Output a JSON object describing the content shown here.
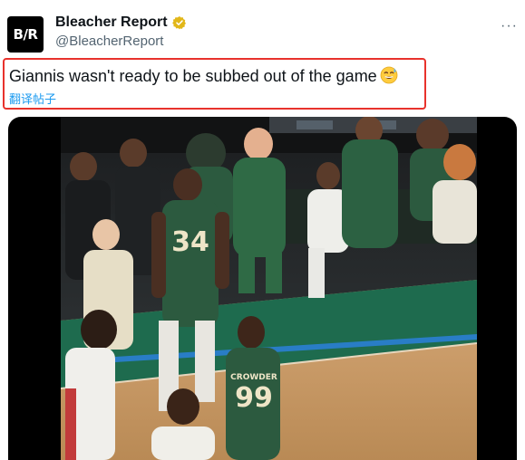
{
  "post": {
    "avatar_text": "B/R",
    "author_name": "Bleacher Report",
    "handle": "@BleacherReport",
    "more_label": "···",
    "text": "Giannis wasn't ready to be subbed out of the game",
    "emoji": "sweat-smile-emoji",
    "translate_label": "翻译帖子"
  },
  "media": {
    "type": "video",
    "jerseys": {
      "player_34": "34",
      "player_99": "99",
      "name_99": "CROWDER"
    }
  },
  "colors": {
    "highlight_border": "#e8322c",
    "link": "#1d9bf0",
    "verified_gold": "#e2b719",
    "court_wood": "#c99a63",
    "court_green": "#1e6b4e",
    "bucks_green": "#2c5a3f"
  }
}
